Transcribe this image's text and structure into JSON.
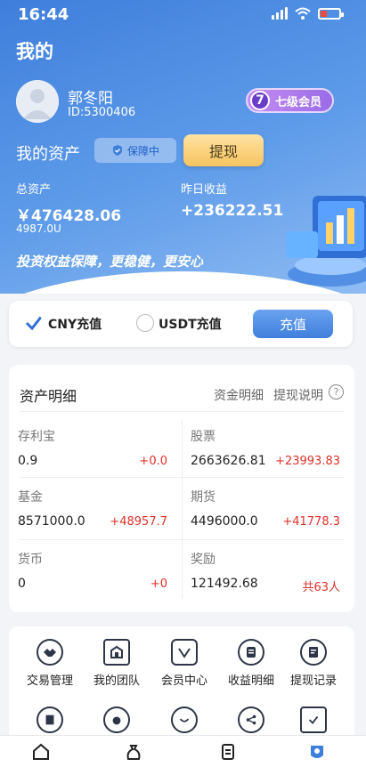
{
  "status": {
    "time": "16:44",
    "battery_level": 0.35
  },
  "header": {
    "title": "我的"
  },
  "user": {
    "name": "郭冬阳",
    "id": "ID:5300406",
    "level_number": "7",
    "level_label": "七级会员"
  },
  "assets": {
    "title": "我的资产",
    "protect_badge": "保障中",
    "withdraw_label": "提现",
    "total_label": "总资产",
    "total_value": "￥476428.06",
    "total_sub": "4987.0U",
    "yesterday_label": "昨日收益",
    "yesterday_value": "+236222.51",
    "slogan": "投资权益保障，更稳健，更安心"
  },
  "recharge": {
    "option1": "CNY充值",
    "option2": "USDT充值",
    "selected": "CNY充值",
    "button": "充值"
  },
  "details": {
    "title": "资产明细",
    "link1": "资金明细",
    "link2": "提现说明",
    "help_icon": "?",
    "cells": [
      {
        "name": "存利宝",
        "value": "0.9",
        "change": "+0.0"
      },
      {
        "name": "股票",
        "value": "2663626.81",
        "change": "+23993.83"
      },
      {
        "name": "基金",
        "value": "8571000.0",
        "change": "+48957.7"
      },
      {
        "name": "期货",
        "value": "4496000.0",
        "change": "+41778.3"
      },
      {
        "name": "货币",
        "value": "0",
        "change": "+0"
      },
      {
        "name": "奖励",
        "value": "121492.68",
        "change": "共63人"
      }
    ]
  },
  "menu": {
    "items": [
      {
        "label": "交易管理",
        "icon": "handshake-icon"
      },
      {
        "label": "我的团队",
        "icon": "team-icon"
      },
      {
        "label": "会员中心",
        "icon": "member-icon"
      },
      {
        "label": "收益明细",
        "icon": "income-icon"
      },
      {
        "label": "提现记录",
        "icon": "withdraw-record-icon"
      }
    ],
    "row2_icons": [
      "document-icon",
      "bag-icon",
      "smile-icon",
      "share-icon",
      "calendar-check-icon"
    ]
  },
  "tabbar": {
    "icons": [
      "home-icon",
      "money-bag-icon",
      "receipt-icon",
      "profile-icon"
    ],
    "active": "profile-icon"
  },
  "colors": {
    "primary": "#3f7fdc",
    "accent_gold": "#f6c35f",
    "positive_red": "#e0302a",
    "level_purple": "#9a6ce8"
  }
}
